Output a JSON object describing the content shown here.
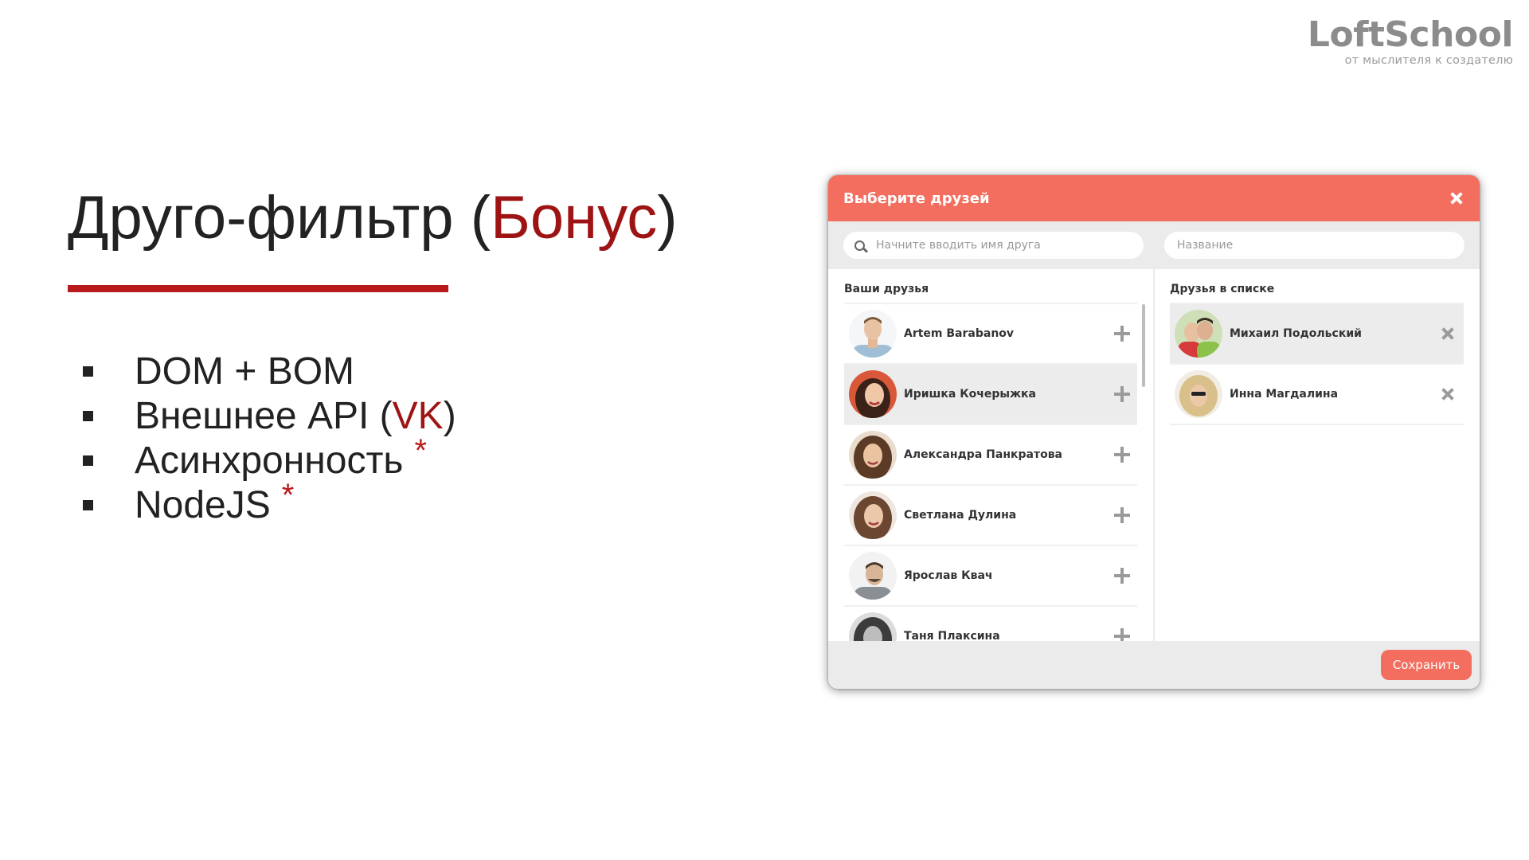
{
  "logo": {
    "wordmark": "LoftSchool",
    "tagline": "от мыслителя к создателю"
  },
  "slide": {
    "title_main": "Друго-фильтр (",
    "title_accent": "Бонус",
    "title_close": ")",
    "bullets": [
      {
        "text": "DOM + BOM",
        "accent": "",
        "suffix": "",
        "star": ""
      },
      {
        "text": "Внешнее API (",
        "accent": "VK",
        "suffix": ")",
        "star": ""
      },
      {
        "text": "Асинхронность",
        "accent": "",
        "suffix": "",
        "star": "*"
      },
      {
        "text": "NodeJS",
        "accent": "",
        "suffix": "",
        "star": "*"
      }
    ]
  },
  "modal": {
    "title": "Выберите друзей",
    "search_placeholder": "Начните вводить имя друга",
    "list_search_placeholder": "Название",
    "your_friends_heading": "Ваши друзья",
    "list_friends_heading": "Друзья в списке",
    "your_friends": [
      {
        "name": "Artem Barabanov"
      },
      {
        "name": "Иришка Кочерыжка"
      },
      {
        "name": "Александра Панкратова"
      },
      {
        "name": "Светлана Дулина"
      },
      {
        "name": "Ярослав Квач"
      },
      {
        "name": "Таня Плаксина"
      }
    ],
    "list_friends": [
      {
        "name": "Михаил Подольский"
      },
      {
        "name": "Инна Магдалина"
      }
    ],
    "save_label": "Сохранить"
  },
  "colors": {
    "accent": "#f36e5e",
    "title_accent": "#9e1414",
    "rule": "#b8191c"
  }
}
